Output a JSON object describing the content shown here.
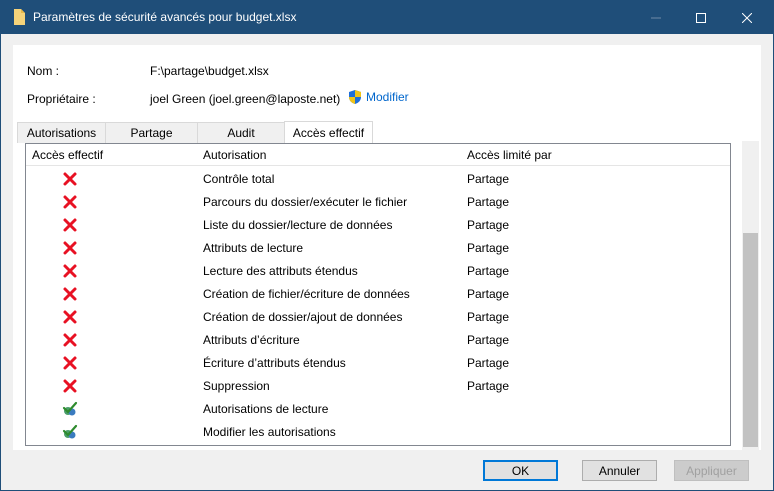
{
  "window": {
    "title": "Paramètres de sécurité avancés pour budget.xlsx",
    "help_label": "—"
  },
  "info": {
    "name_label": "Nom :",
    "name_value": "F:\\partage\\budget.xlsx",
    "owner_label": "Propriétaire :",
    "owner_value": "joel Green (joel.green@laposte.net)",
    "modify_label": "Modifier"
  },
  "tabs": [
    {
      "label": "Autorisations"
    },
    {
      "label": "Partage"
    },
    {
      "label": "Audit"
    },
    {
      "label": "Accès effectif"
    }
  ],
  "table": {
    "headers": {
      "effective": "Accès effectif",
      "permission": "Autorisation",
      "limited_by": "Accès limité par"
    },
    "rows": [
      {
        "status": "deny",
        "permission": "Contrôle total",
        "limited_by": "Partage"
      },
      {
        "status": "deny",
        "permission": "Parcours du dossier/exécuter le fichier",
        "limited_by": "Partage"
      },
      {
        "status": "deny",
        "permission": "Liste du dossier/lecture de données",
        "limited_by": "Partage"
      },
      {
        "status": "deny",
        "permission": "Attributs de lecture",
        "limited_by": "Partage"
      },
      {
        "status": "deny",
        "permission": "Lecture des attributs étendus",
        "limited_by": "Partage"
      },
      {
        "status": "deny",
        "permission": "Création de fichier/écriture de données",
        "limited_by": "Partage"
      },
      {
        "status": "deny",
        "permission": "Création de dossier/ajout de données",
        "limited_by": "Partage"
      },
      {
        "status": "deny",
        "permission": "Attributs d’écriture",
        "limited_by": "Partage"
      },
      {
        "status": "deny",
        "permission": "Écriture d’attributs étendus",
        "limited_by": "Partage"
      },
      {
        "status": "deny",
        "permission": "Suppression",
        "limited_by": "Partage"
      },
      {
        "status": "allow",
        "permission": "Autorisations de lecture",
        "limited_by": ""
      },
      {
        "status": "allow",
        "permission": "Modifier les autorisations",
        "limited_by": ""
      }
    ]
  },
  "buttons": {
    "ok": "OK",
    "cancel": "Annuler",
    "apply": "Appliquer"
  },
  "colors": {
    "titlebar": "#1f4e79",
    "deny": "#e81123",
    "link": "#0066cc"
  }
}
